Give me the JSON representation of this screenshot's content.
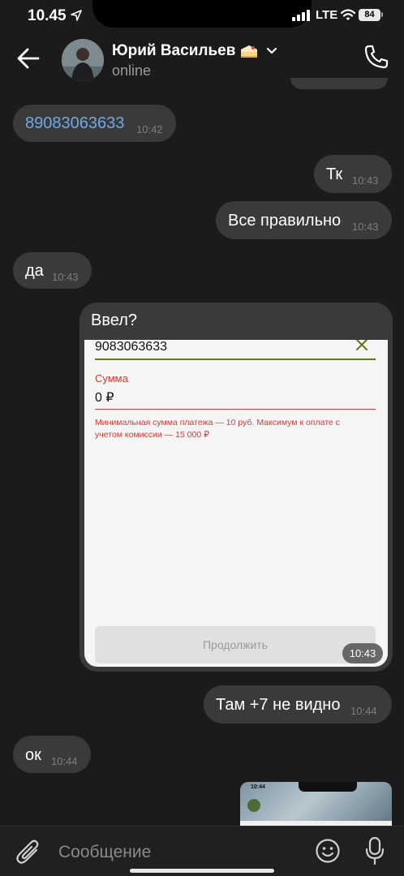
{
  "status_bar": {
    "time": "10.45",
    "network": "LTE",
    "battery": "84"
  },
  "header": {
    "contact_name": "Юрий Васильев",
    "status": "online"
  },
  "messages": [
    {
      "text": "89083063633",
      "time": "10:42"
    },
    {
      "text": "Тк",
      "time": "10:43"
    },
    {
      "text": "Все правильно",
      "time": "10:43"
    },
    {
      "text": "да",
      "time": "10:43"
    },
    {
      "text": "Там +7 не видно",
      "time": "10:44"
    },
    {
      "text": "ок",
      "time": "10:44"
    }
  ],
  "image_message": {
    "caption": "Ввел?",
    "time": "10:43",
    "screenshot": {
      "phone_value": "9083063633",
      "amount_label": "Сумма",
      "amount_value": "0 ₽",
      "amount_error": "Минимальная сумма платежа — 10 руб. Максимум к оплате с учетом комиссии — 15 000 ₽",
      "continue_label": "Продолжить"
    }
  },
  "partial_image": {
    "time": "10:44"
  },
  "composer": {
    "placeholder": "Сообщение"
  },
  "colors": {
    "bubble": "#3a3a3a",
    "link": "#6fa8e6",
    "error": "#cf3c34",
    "background": "#1b1b1b"
  }
}
